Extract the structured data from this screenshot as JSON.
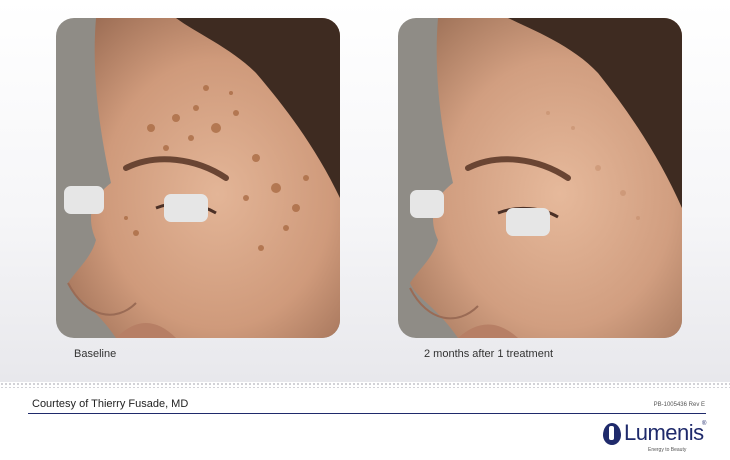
{
  "photos": [
    {
      "caption": "Baseline",
      "icon": "face-profile-before-photo"
    },
    {
      "caption": "2 months after 1 treatment",
      "icon": "face-profile-after-photo"
    }
  ],
  "footer": {
    "credit": "Courtesy of Thierry Fusade, MD",
    "reference": "PB-1005436 Rev E"
  },
  "logo": {
    "name": "Lumenis",
    "registered": "®",
    "tagline": "Energy to Beauty",
    "color": "#1f2a6b"
  }
}
